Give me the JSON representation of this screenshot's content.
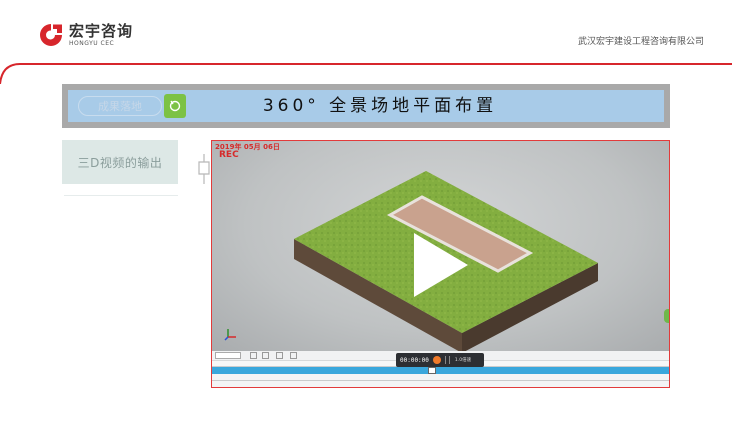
{
  "header": {
    "logo_name": "宏宇咨询",
    "logo_sub": "HONGYU CEC",
    "company_name": "武汉宏宇建设工程咨询有限公司"
  },
  "title_bar": {
    "tab_label": "成果落地",
    "title": "360° 全景场地平面布置"
  },
  "sidebar": {
    "items": [
      {
        "label": "三D视频的输出"
      }
    ]
  },
  "video": {
    "date_stamp": "2019年 05月 06日",
    "rec_label": "REC",
    "time": "00:00:00",
    "speed": "1.0倍速",
    "play_icon": "play-icon",
    "record_icon": "record-icon"
  },
  "colors": {
    "brand_red": "#d7262c",
    "title_bar_blue": "#a8cbe8",
    "timeline_blue": "#3aa7dc",
    "video_border": "#e23b3b",
    "grass_green": "#7faa3c"
  }
}
